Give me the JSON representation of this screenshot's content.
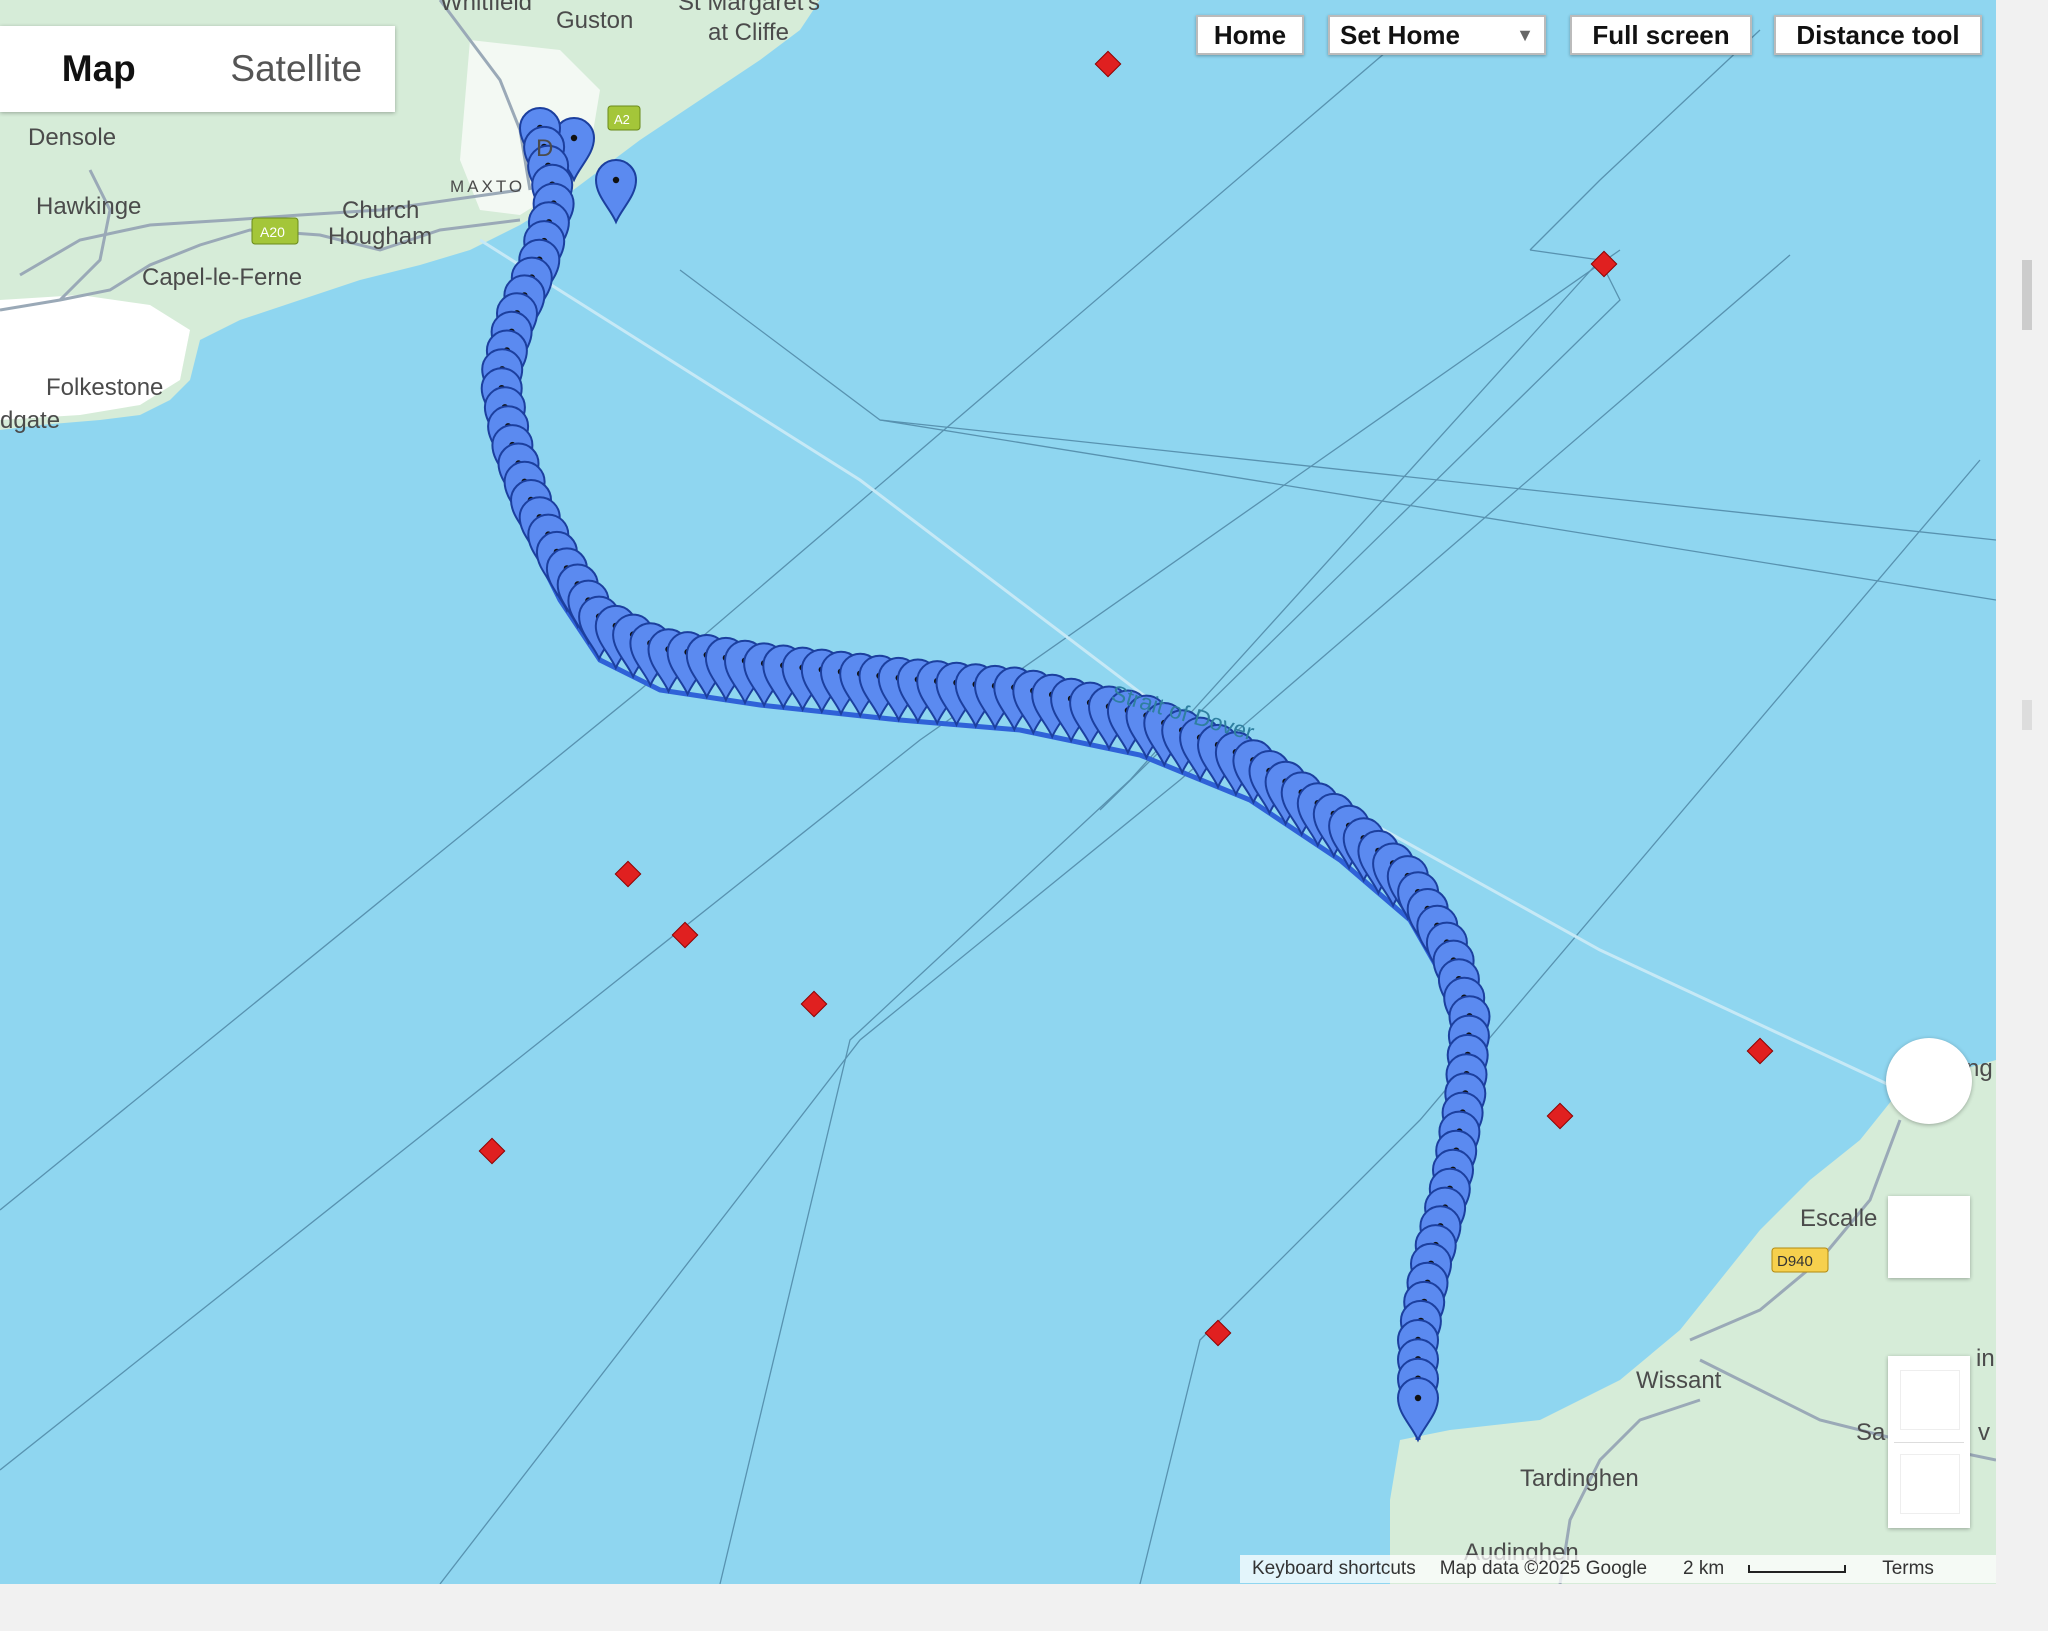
{
  "map_type": {
    "map": "Map",
    "satellite": "Satellite"
  },
  "controls": {
    "home": "Home",
    "set_home": "Set Home",
    "full_screen": "Full screen",
    "distance_tool": "Distance tool"
  },
  "place_labels": {
    "whitfield": "Whitfield",
    "guston": "Guston",
    "st_margarets": "St Margaret's",
    "at_cliffe": "at Cliffe",
    "densole": "Densole",
    "hawkinge": "Hawkinge",
    "church": "Church",
    "hougham": "Hougham",
    "maxton": "MAXTO",
    "dover": "D",
    "capel": "Capel-le-Ferne",
    "folkestone": "Folkestone",
    "sandgate": "dgate",
    "strait": "Strait of Dover",
    "escalles": "Escalle",
    "wissant": "Wissant",
    "tardinghen": "Tardinghen",
    "audinghen": "Audinghen",
    "road_a20": "A20",
    "road_a2": "A2",
    "road_d940": "D940",
    "partial_ng": "ng",
    "partial_in": "in",
    "partial_sa": "Sa",
    "partial_v": "v"
  },
  "footer": {
    "shortcuts": "Keyboard shortcuts",
    "map_data": "Map data ©2025 Google",
    "scale": "2 km",
    "terms": "Terms"
  },
  "colors": {
    "sea": "#8fd6f0",
    "land": "#d6ecd8",
    "marker": "#5b8af0",
    "marker_stroke": "#1c3f9e",
    "diamond": "#e02020"
  },
  "markers": {
    "icon": "map-pin-icon",
    "count": 103
  },
  "buoys": {
    "icon": "red-diamond-icon",
    "count": 10
  }
}
